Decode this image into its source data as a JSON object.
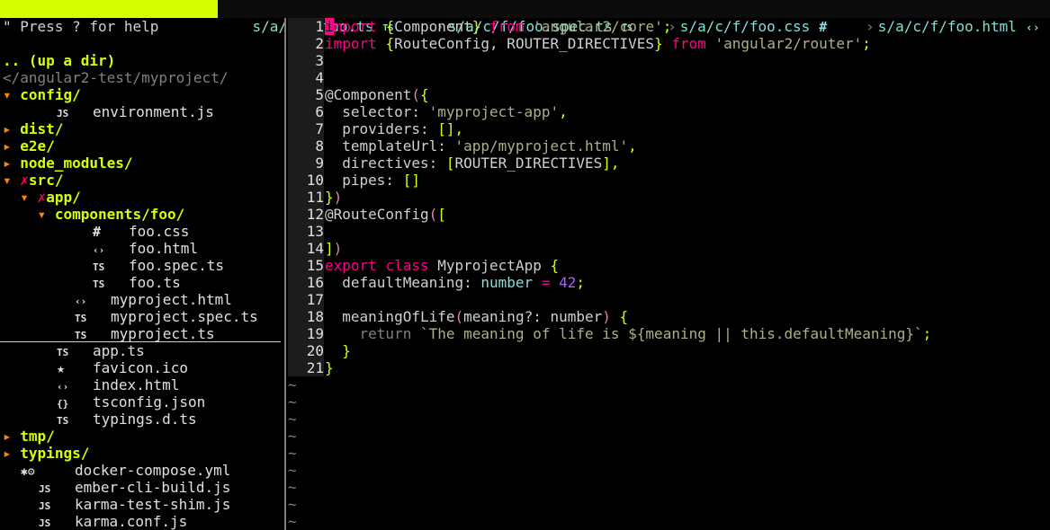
{
  "tabs": [
    {
      "label": "s/a/myproject.ts",
      "icon": "TS",
      "active": true
    },
    {
      "label": "s/a/c/f/foo.ts",
      "icon": "TS",
      "active": false
    },
    {
      "label": "s/a/c/f/foo.spec.ts",
      "icon": "TS",
      "active": false
    },
    {
      "label": "s/a/c/f/foo.css",
      "icon": "#",
      "active": false
    },
    {
      "label": "s/a/c/f/foo.html",
      "icon": "‹›",
      "active": false
    }
  ],
  "tree": {
    "help": "\" Press ? for help",
    "updir": ".. (up a dir)",
    "cwd": "</angular2-test/myproject/",
    "items": {
      "config": "config",
      "environment_js": "environment.js",
      "dist": "dist",
      "e2e": "e2e",
      "node_modules": "node_modules",
      "src": "src",
      "app": "app",
      "components_foo": "components/foo",
      "foo_css": "foo.css",
      "foo_html": "foo.html",
      "foo_spec_ts": "foo.spec.ts",
      "foo_ts": "foo.ts",
      "myproject_html": "myproject.html",
      "myproject_spec_ts": "myproject.spec.ts",
      "myproject_ts": "myproject.ts",
      "app_ts": "app.ts",
      "favicon_ico": "favicon.ico",
      "index_html": "index.html",
      "tsconfig_json": "tsconfig.json",
      "typings_d_ts": "typings.d.ts",
      "tmp": "tmp",
      "typings": "typings",
      "docker_compose": "docker-compose.yml",
      "ember_cli_build": "ember-cli-build.js",
      "karma_test_shim": "karma-test-shim.js",
      "karma_conf": "karma.conf.js"
    },
    "icons": {
      "js": "JS",
      "ts": "TS",
      "css": "#",
      "html": "‹›",
      "json": "{}",
      "ico": "★",
      "docker": "✱⚙",
      "dir_open": "▾",
      "dir_closed": "▸",
      "git_mod": "✗"
    }
  },
  "editor": {
    "line_numbers": [
      "1",
      "2",
      "3",
      "4",
      "5",
      "6",
      "7",
      "8",
      "9",
      "10",
      "11",
      "12",
      "13",
      "14",
      "15",
      "16",
      "17",
      "18",
      "19",
      "20",
      "21"
    ],
    "tilde": "~",
    "code": {
      "l1": {
        "a": "import",
        "b": " ",
        "c": "{",
        "d": "Component",
        "e": "}",
        "f": " ",
        "g": "from",
        "h": " ",
        "i": "'angular2/core'",
        "j": ";"
      },
      "l2": {
        "a": "import",
        "b": " ",
        "c": "{",
        "d": "RouteConfig, ROUTER_DIRECTIVES",
        "e": "}",
        "f": " ",
        "g": "from",
        "h": " ",
        "i": "'angular2/router'",
        "j": ";"
      },
      "l5": {
        "a": "@Component",
        "b": "(",
        "c": "{"
      },
      "l6": {
        "a": "  selector: ",
        "b": "'myproject-app'",
        "c": ","
      },
      "l7": {
        "a": "  providers: ",
        "b": "[]",
        "c": ","
      },
      "l8": {
        "a": "  templateUrl: ",
        "b": "'app/myproject.html'",
        "c": ","
      },
      "l9": {
        "a": "  directives: ",
        "b": "[",
        "c": "ROUTER_DIRECTIVES",
        "d": "]",
        "e": ","
      },
      "l10": {
        "a": "  pipes: ",
        "b": "[]"
      },
      "l11": {
        "a": "}",
        "b": ")"
      },
      "l12": {
        "a": "@RouteConfig",
        "b": "(",
        "c": "["
      },
      "l14": {
        "a": "]",
        "b": ")"
      },
      "l15": {
        "a": "export",
        "b": " ",
        "c": "class",
        "d": " MyprojectApp ",
        "e": "{"
      },
      "l16": {
        "a": "  defaultMeaning: ",
        "b": "number",
        "c": " = ",
        "d": "42",
        "e": ";"
      },
      "l18": {
        "a": "  meaningOfLife",
        "b": "(",
        "c": "meaning?: number",
        "d": ")",
        "e": " ",
        "f": "{"
      },
      "l19": {
        "a": "    return ",
        "b": "`The meaning of life is ${meaning || this.defaultMeaning}`",
        "c": ";"
      },
      "l20": {
        "a": "  ",
        "b": "}"
      },
      "l21": {
        "a": "}"
      }
    }
  }
}
